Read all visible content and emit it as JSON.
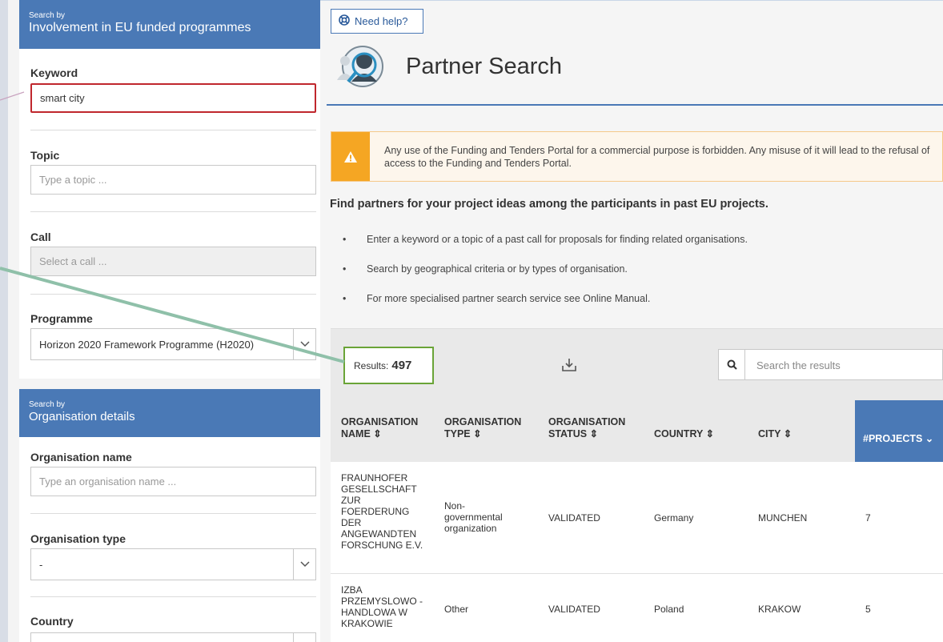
{
  "sidebar": {
    "eu_section": {
      "small": "Search by",
      "title": "Involvement in EU funded programmes"
    },
    "keyword": {
      "label": "Keyword",
      "value": "smart city"
    },
    "topic": {
      "label": "Topic",
      "placeholder": "Type a topic ..."
    },
    "call": {
      "label": "Call",
      "placeholder": "Select a call ..."
    },
    "programme": {
      "label": "Programme",
      "selected": "Horizon 2020 Framework Programme (H2020)"
    },
    "org_section": {
      "small": "Search by",
      "title": "Organisation details"
    },
    "org_name": {
      "label": "Organisation name",
      "placeholder": "Type an organisation name ..."
    },
    "org_type": {
      "label": "Organisation type",
      "selected": "-"
    },
    "country": {
      "label": "Country"
    }
  },
  "main": {
    "help_label": "Need help?",
    "title": "Partner Search",
    "warning": "Any use of the Funding and Tenders Portal for a commercial purpose is forbidden. Any misuse of it will lead to the refusal of access to the Funding and Tenders Portal.",
    "intro": "Find partners for your project ideas among the participants in past EU projects.",
    "bullets": [
      "Enter a keyword or a topic of a past call for proposals for finding related organisations.",
      "Search by geographical criteria or by types of organisation.",
      "For more specialised partner search service see Online Manual."
    ],
    "results_label": "Results:",
    "results_count": "497",
    "search_placeholder": "Search the results"
  },
  "table": {
    "headers": [
      {
        "line1": "ORGANISATION",
        "line2": "NAME ⇕"
      },
      {
        "line1": "ORGANISATION",
        "line2": "TYPE ⇕"
      },
      {
        "line1": "ORGANISATION",
        "line2": "STATUS ⇕"
      },
      {
        "line1": "",
        "line2": "COUNTRY ⇕"
      },
      {
        "line1": "",
        "line2": "CITY ⇕"
      },
      {
        "line1": "",
        "line2": "#PROJECTS ⌄"
      }
    ],
    "rows": [
      {
        "name": [
          "FRAUNHOFER",
          "GESELLSCHAFT",
          "ZUR",
          "FOERDERUNG",
          "DER",
          "ANGEWANDTEN",
          "FORSCHUNG E.V."
        ],
        "type": [
          "Non-",
          "governmental",
          "organization"
        ],
        "status": "VALIDATED",
        "country": "Germany",
        "city": "MUNCHEN",
        "projects": "7"
      },
      {
        "name": [
          "IZBA",
          "PRZEMYSLOWO -",
          "HANDLOWA W",
          "KRAKOWIE"
        ],
        "type": [
          "Other"
        ],
        "status": "VALIDATED",
        "country": "Poland",
        "city": "KRAKOW",
        "projects": "5"
      }
    ]
  },
  "colors": {
    "accent": "#4a79b6",
    "warning": "#f5a623",
    "highlight_red": "#c0272d",
    "highlight_green": "#6aa437",
    "arrow": "#8fc0a9"
  }
}
